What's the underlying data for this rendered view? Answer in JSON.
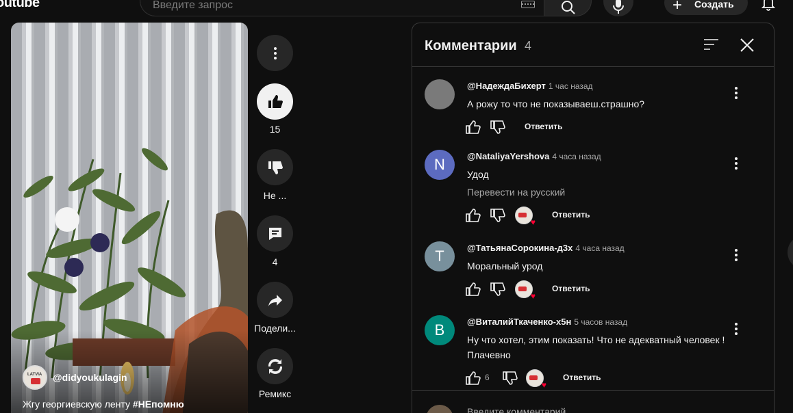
{
  "header": {
    "logo_text": "outube",
    "search_placeholder": "Введите запрос",
    "create_label": "Создать"
  },
  "video": {
    "owner_handle": "@didyoukulagin",
    "owner_avatar_text": "LATVIA",
    "caption_text": "Жгу георгиевскую ленту ",
    "caption_tag": "#НЕпомню"
  },
  "actions": {
    "likes": "15",
    "dislike_label": "Не ...",
    "comments": "4",
    "share_label": "Подели...",
    "remix_label": "Ремикс"
  },
  "comments_panel": {
    "title": "Комментарии",
    "count": "4",
    "reply_label": "Ответить",
    "input_placeholder": "Введите комментарий",
    "items": [
      {
        "author": "@НадеждаБихерт",
        "time": "1 час назад",
        "text": "А рожу то что не показываеш.страшно?",
        "avatar_letter": "",
        "avatar_color": "#7a7a7a",
        "likes": "",
        "creator_heart": false
      },
      {
        "author": "@NataliyaYershova",
        "time": "4 часа назад",
        "text": "Удод",
        "translate": "Перевести на русский",
        "avatar_letter": "N",
        "avatar_color": "#5c6bc0",
        "likes": "",
        "creator_heart": true
      },
      {
        "author": "@ТатьянаСорокина-д3х",
        "time": "4 часа назад",
        "text": "Моральный урод",
        "avatar_letter": "T",
        "avatar_color": "#78909c",
        "likes": "",
        "creator_heart": true
      },
      {
        "author": "@ВиталийТкаченко-х5н",
        "time": "5 часов назад",
        "text": "Ну что хотел, этим показать! Что не адекватный человек ! Плачевно",
        "avatar_letter": "B",
        "avatar_color": "#00897b",
        "likes": "6",
        "creator_heart": true
      }
    ]
  },
  "colors": {
    "background": "#0f0f0f",
    "surface": "#272727",
    "border": "#3a3a3a",
    "text_primary": "#f1f1f1",
    "text_secondary": "#aaaaaa",
    "heart_red": "#ff0033"
  }
}
